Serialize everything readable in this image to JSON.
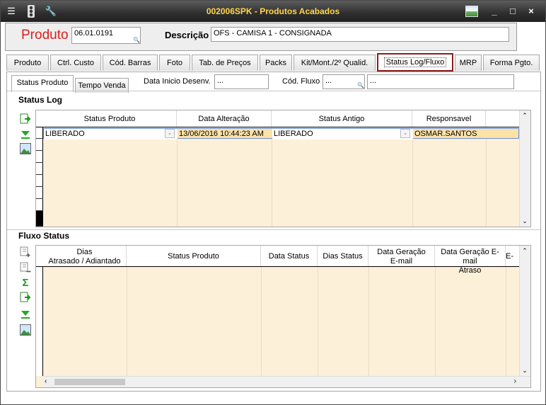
{
  "window": {
    "title": "002006SPK - Produtos Acabados",
    "controls": [
      "_",
      "□",
      "×"
    ]
  },
  "header": {
    "produto_label": "Produto",
    "produto_value": "06.01.0191",
    "descricao_label": "Descrição",
    "descricao_value": "OFS - CAMISA 1 - CONSIGNADA"
  },
  "tabs": [
    {
      "label": "Produto"
    },
    {
      "label": "Ctrl. Custo"
    },
    {
      "label": "Cód. Barras"
    },
    {
      "label": "Foto"
    },
    {
      "label": "Tab. de Preços"
    },
    {
      "label": "Packs"
    },
    {
      "label": "Kit/Mont./2º Qualid."
    },
    {
      "label": "Status Log/Fluxo"
    },
    {
      "label": "MRP"
    },
    {
      "label": "Forma Pgto."
    }
  ],
  "subtabs": [
    {
      "label": "Status Produto"
    },
    {
      "label": "Tempo Venda"
    }
  ],
  "filters": {
    "data_inicio_label": "Data Inicio Desenv.",
    "data_inicio_value": "...",
    "cod_fluxo_label": "Cód. Fluxo",
    "cod_fluxo_value": "...",
    "cod_fluxo_desc": "..."
  },
  "status_log": {
    "title": "Status Log",
    "columns": [
      "Status Produto",
      "Data Alteração",
      "Status Antigo",
      "Responsavel"
    ],
    "rows": [
      [
        "LIBERADO",
        "13/06/2016 10:44:23 AM",
        "LIBERADO",
        "OSMAR.SANTOS"
      ]
    ]
  },
  "fluxo_status": {
    "title": "Fluxo Status",
    "columns": [
      {
        "l1": "Dias",
        "l2": "Atrasado / Adiantado"
      },
      {
        "l1": "Status Produto",
        "l2": ""
      },
      {
        "l1": "Data Status",
        "l2": ""
      },
      {
        "l1": "Dias Status",
        "l2": ""
      },
      {
        "l1": "Data Geração",
        "l2": "E-mail"
      },
      {
        "l1": "Data Geração E-mail",
        "l2": "Atraso"
      },
      {
        "l1": "E-ma",
        "l2": ""
      }
    ]
  },
  "colors": {
    "title_text": "#ffd54a",
    "produto_label": "#e01b1b",
    "active_tab_border": "#8b1c1c",
    "grid_bg": "#fdf0d8",
    "selected_row": "#fde2a8"
  },
  "icons": [
    "menu-icon",
    "traffic-light-icon",
    "wrench-icon",
    "image-icon",
    "export-icon",
    "download-icon",
    "sum-icon",
    "add-row-icon",
    "remove-row-icon"
  ]
}
